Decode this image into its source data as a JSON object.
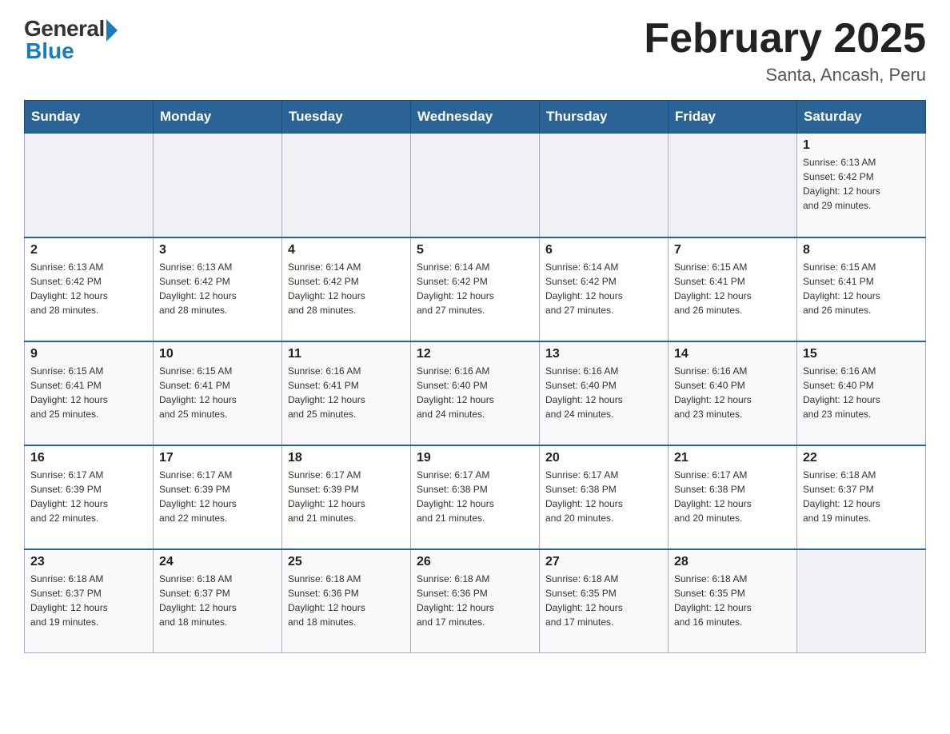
{
  "logo": {
    "general": "General",
    "blue": "Blue"
  },
  "title": "February 2025",
  "subtitle": "Santa, Ancash, Peru",
  "days_header": [
    "Sunday",
    "Monday",
    "Tuesday",
    "Wednesday",
    "Thursday",
    "Friday",
    "Saturday"
  ],
  "weeks": [
    [
      {
        "day": "",
        "info": ""
      },
      {
        "day": "",
        "info": ""
      },
      {
        "day": "",
        "info": ""
      },
      {
        "day": "",
        "info": ""
      },
      {
        "day": "",
        "info": ""
      },
      {
        "day": "",
        "info": ""
      },
      {
        "day": "1",
        "info": "Sunrise: 6:13 AM\nSunset: 6:42 PM\nDaylight: 12 hours\nand 29 minutes."
      }
    ],
    [
      {
        "day": "2",
        "info": "Sunrise: 6:13 AM\nSunset: 6:42 PM\nDaylight: 12 hours\nand 28 minutes."
      },
      {
        "day": "3",
        "info": "Sunrise: 6:13 AM\nSunset: 6:42 PM\nDaylight: 12 hours\nand 28 minutes."
      },
      {
        "day": "4",
        "info": "Sunrise: 6:14 AM\nSunset: 6:42 PM\nDaylight: 12 hours\nand 28 minutes."
      },
      {
        "day": "5",
        "info": "Sunrise: 6:14 AM\nSunset: 6:42 PM\nDaylight: 12 hours\nand 27 minutes."
      },
      {
        "day": "6",
        "info": "Sunrise: 6:14 AM\nSunset: 6:42 PM\nDaylight: 12 hours\nand 27 minutes."
      },
      {
        "day": "7",
        "info": "Sunrise: 6:15 AM\nSunset: 6:41 PM\nDaylight: 12 hours\nand 26 minutes."
      },
      {
        "day": "8",
        "info": "Sunrise: 6:15 AM\nSunset: 6:41 PM\nDaylight: 12 hours\nand 26 minutes."
      }
    ],
    [
      {
        "day": "9",
        "info": "Sunrise: 6:15 AM\nSunset: 6:41 PM\nDaylight: 12 hours\nand 25 minutes."
      },
      {
        "day": "10",
        "info": "Sunrise: 6:15 AM\nSunset: 6:41 PM\nDaylight: 12 hours\nand 25 minutes."
      },
      {
        "day": "11",
        "info": "Sunrise: 6:16 AM\nSunset: 6:41 PM\nDaylight: 12 hours\nand 25 minutes."
      },
      {
        "day": "12",
        "info": "Sunrise: 6:16 AM\nSunset: 6:40 PM\nDaylight: 12 hours\nand 24 minutes."
      },
      {
        "day": "13",
        "info": "Sunrise: 6:16 AM\nSunset: 6:40 PM\nDaylight: 12 hours\nand 24 minutes."
      },
      {
        "day": "14",
        "info": "Sunrise: 6:16 AM\nSunset: 6:40 PM\nDaylight: 12 hours\nand 23 minutes."
      },
      {
        "day": "15",
        "info": "Sunrise: 6:16 AM\nSunset: 6:40 PM\nDaylight: 12 hours\nand 23 minutes."
      }
    ],
    [
      {
        "day": "16",
        "info": "Sunrise: 6:17 AM\nSunset: 6:39 PM\nDaylight: 12 hours\nand 22 minutes."
      },
      {
        "day": "17",
        "info": "Sunrise: 6:17 AM\nSunset: 6:39 PM\nDaylight: 12 hours\nand 22 minutes."
      },
      {
        "day": "18",
        "info": "Sunrise: 6:17 AM\nSunset: 6:39 PM\nDaylight: 12 hours\nand 21 minutes."
      },
      {
        "day": "19",
        "info": "Sunrise: 6:17 AM\nSunset: 6:38 PM\nDaylight: 12 hours\nand 21 minutes."
      },
      {
        "day": "20",
        "info": "Sunrise: 6:17 AM\nSunset: 6:38 PM\nDaylight: 12 hours\nand 20 minutes."
      },
      {
        "day": "21",
        "info": "Sunrise: 6:17 AM\nSunset: 6:38 PM\nDaylight: 12 hours\nand 20 minutes."
      },
      {
        "day": "22",
        "info": "Sunrise: 6:18 AM\nSunset: 6:37 PM\nDaylight: 12 hours\nand 19 minutes."
      }
    ],
    [
      {
        "day": "23",
        "info": "Sunrise: 6:18 AM\nSunset: 6:37 PM\nDaylight: 12 hours\nand 19 minutes."
      },
      {
        "day": "24",
        "info": "Sunrise: 6:18 AM\nSunset: 6:37 PM\nDaylight: 12 hours\nand 18 minutes."
      },
      {
        "day": "25",
        "info": "Sunrise: 6:18 AM\nSunset: 6:36 PM\nDaylight: 12 hours\nand 18 minutes."
      },
      {
        "day": "26",
        "info": "Sunrise: 6:18 AM\nSunset: 6:36 PM\nDaylight: 12 hours\nand 17 minutes."
      },
      {
        "day": "27",
        "info": "Sunrise: 6:18 AM\nSunset: 6:35 PM\nDaylight: 12 hours\nand 17 minutes."
      },
      {
        "day": "28",
        "info": "Sunrise: 6:18 AM\nSunset: 6:35 PM\nDaylight: 12 hours\nand 16 minutes."
      },
      {
        "day": "",
        "info": ""
      }
    ]
  ]
}
